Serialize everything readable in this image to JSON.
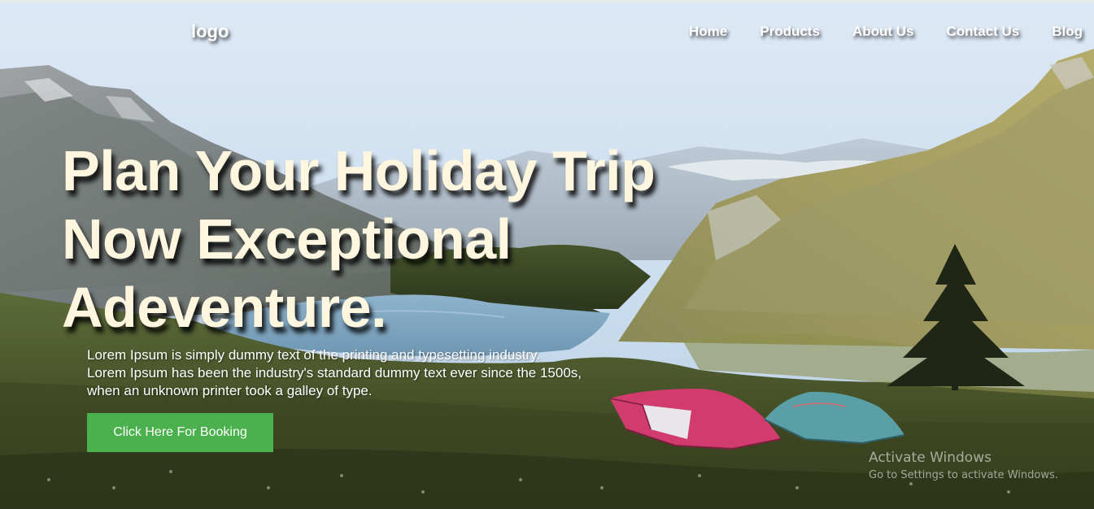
{
  "navbar": {
    "logo": "logo",
    "links": [
      {
        "label": "Home"
      },
      {
        "label": "Products"
      },
      {
        "label": "About Us"
      },
      {
        "label": "Contact Us"
      },
      {
        "label": "Blog"
      }
    ]
  },
  "hero": {
    "title_lines": [
      "Plan Your Holiday Trip",
      "Now Exceptional",
      "Adeventure."
    ],
    "description_lines": [
      "Lorem Ipsum is simply dummy text of the printing and typesetting industry.",
      "Lorem Ipsum has been the industry's standard dummy text ever since the 1500s,",
      "when an unknown printer took a galley of type."
    ],
    "button_label": "Click Here For Booking",
    "button_color": "#4bb14e",
    "title_color": "#fff6df"
  },
  "watermark": {
    "title": "Activate Windows",
    "subtitle": "Go to Settings to activate Windows."
  }
}
